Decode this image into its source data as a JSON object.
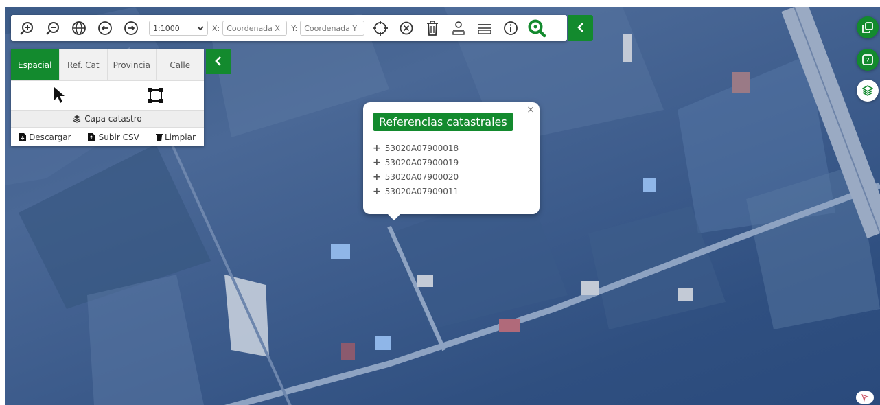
{
  "toolbar": {
    "scale": "1:1000",
    "x_label": "X:",
    "y_label": "Y:",
    "x_placeholder": "Coordenada X",
    "y_placeholder": "Coordenada Y",
    "icons": [
      "zoom-in-icon",
      "zoom-out-icon",
      "globe-icon",
      "back-icon",
      "forward-icon",
      "locate-icon",
      "clear-icon",
      "trash-icon",
      "measure-area-icon",
      "measure-distance-icon",
      "info-icon",
      "search-parcel-icon",
      "collapse-icon"
    ]
  },
  "panel": {
    "tabs": [
      "Espacial",
      "Ref. Cat",
      "Provincia",
      "Calle"
    ],
    "active_tab": "Espacial",
    "layer_label": "Capa catastro",
    "actions": [
      "Descargar",
      "Subir CSV",
      "Limpiar"
    ]
  },
  "popup": {
    "title": "Referencias catastrales",
    "close": "×",
    "items": [
      "53020A07900018",
      "53020A07900019",
      "53020A07900020",
      "53020A07909011"
    ]
  },
  "colors": {
    "accent": "#138a2e",
    "map_tint": "#3a5a8a"
  }
}
